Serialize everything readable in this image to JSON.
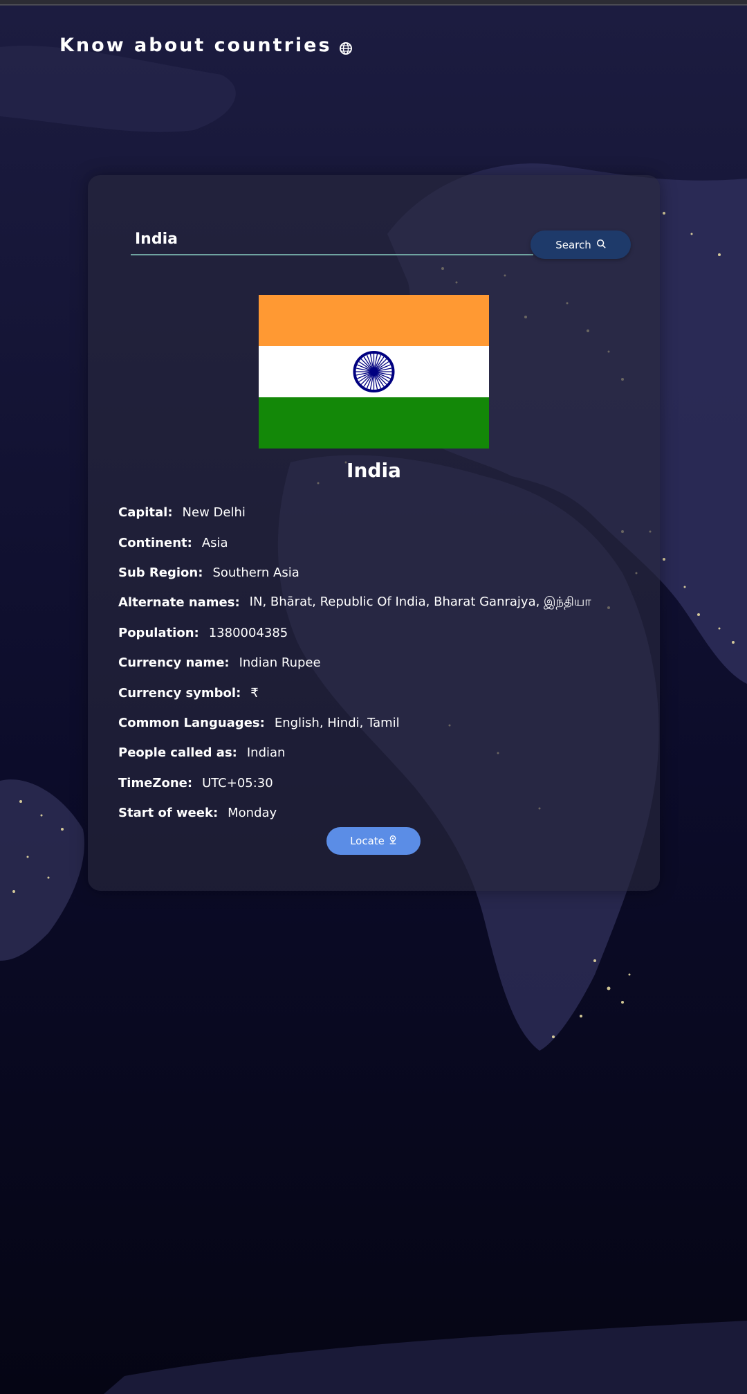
{
  "header": {
    "title": "Know about countries",
    "icon": "globe-icon"
  },
  "search": {
    "value": "India",
    "button_label": "Search",
    "button_icon": "search-icon"
  },
  "country": {
    "name": "India",
    "flag": {
      "colors": [
        "#FF9933",
        "#FFFFFF",
        "#138808"
      ],
      "chakra_color": "#000080"
    },
    "details": [
      {
        "label": "Capital:",
        "value": "New Delhi"
      },
      {
        "label": "Continent:",
        "value": "Asia"
      },
      {
        "label": "Sub Region:",
        "value": "Southern Asia"
      },
      {
        "label": "Alternate names:",
        "value": "IN, Bhārat, Republic Of India, Bharat Ganrajya, இந்தியா"
      },
      {
        "label": "Population:",
        "value": "1380004385"
      },
      {
        "label": "Currency name:",
        "value": "Indian Rupee"
      },
      {
        "label": "Currency symbol:",
        "value": "₹"
      },
      {
        "label": "Common Languages:",
        "value": "English, Hindi, Tamil"
      },
      {
        "label": "People called as:",
        "value": "Indian"
      },
      {
        "label": "TimeZone:",
        "value": "UTC+05:30"
      },
      {
        "label": "Start of week:",
        "value": "Monday"
      }
    ]
  },
  "locate": {
    "label": "Locate",
    "icon": "location-pin-icon"
  },
  "colors": {
    "search_button": "#1e3a6a",
    "locate_button": "#5b8de6",
    "input_underline": "#6fa3a0"
  }
}
